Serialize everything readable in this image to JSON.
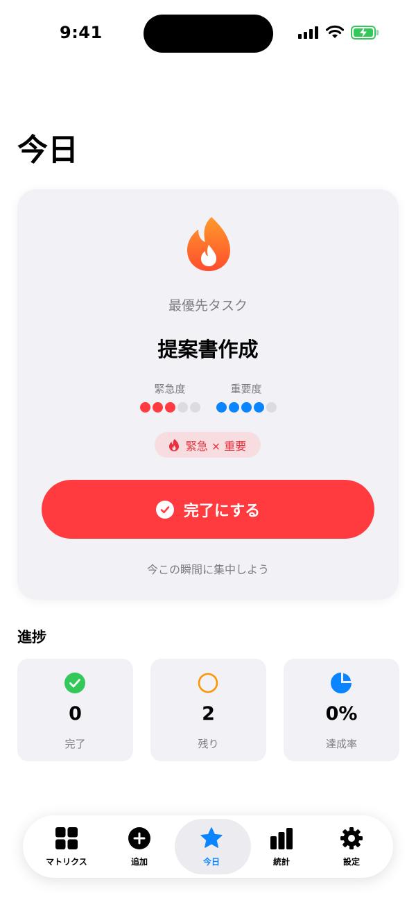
{
  "status_bar": {
    "time": "9:41"
  },
  "page_title": "今日",
  "focus_card": {
    "subtitle": "最優先タスク",
    "task_title": "提案書作成",
    "urgency": {
      "label": "緊急度",
      "level": 3,
      "max": 5,
      "color": "#ff3b3f"
    },
    "importance": {
      "label": "重要度",
      "level": 4,
      "max": 5,
      "color": "#0a84ff"
    },
    "tag_label": "緊急 × 重要",
    "complete_label": "完了にする",
    "footer": "今この瞬間に集中しよう"
  },
  "progress": {
    "title": "進捗",
    "stats": [
      {
        "icon": "checkmark-circle-icon",
        "value": "0",
        "caption": "完了"
      },
      {
        "icon": "circle-outline-icon",
        "value": "2",
        "caption": "残り"
      },
      {
        "icon": "pie-chart-icon",
        "value": "0%",
        "caption": "達成率"
      }
    ]
  },
  "tab_bar": {
    "items": [
      {
        "icon": "grid-icon",
        "label": "マトリクス"
      },
      {
        "icon": "plus-circle-icon",
        "label": "追加"
      },
      {
        "icon": "star-icon",
        "label": "今日"
      },
      {
        "icon": "bar-chart-icon",
        "label": "統計"
      },
      {
        "icon": "gear-icon",
        "label": "設定"
      }
    ],
    "active_index": 2
  },
  "colors": {
    "accent_red": "#ff3b3f",
    "accent_blue": "#0a84ff",
    "success_green": "#34c759",
    "orange": "#ff9500"
  }
}
